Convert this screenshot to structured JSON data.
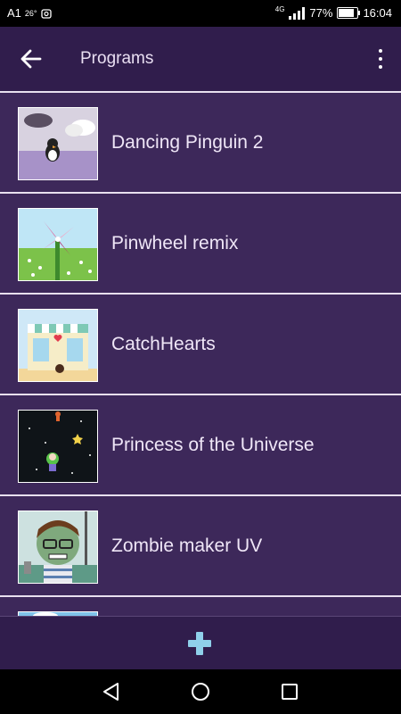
{
  "status_bar": {
    "carrier": "A1",
    "temperature": "26°",
    "network": "4G",
    "battery": "77%",
    "time": "16:04"
  },
  "app_bar": {
    "title": "Programs"
  },
  "programs": [
    {
      "name": "Dancing Pinguin 2"
    },
    {
      "name": "Pinwheel remix"
    },
    {
      "name": "CatchHearts"
    },
    {
      "name": "Princess of the Universe"
    },
    {
      "name": "Zombie maker UV"
    },
    {
      "name": ""
    }
  ],
  "colors": {
    "background": "#3b2657",
    "app_bar": "#301d4c",
    "divider": "#e8e0ef",
    "add_icon": "#8fd0ea"
  },
  "icons": {
    "back": "arrow-left-icon",
    "menu": "more-vert-icon",
    "add": "plus-icon"
  }
}
